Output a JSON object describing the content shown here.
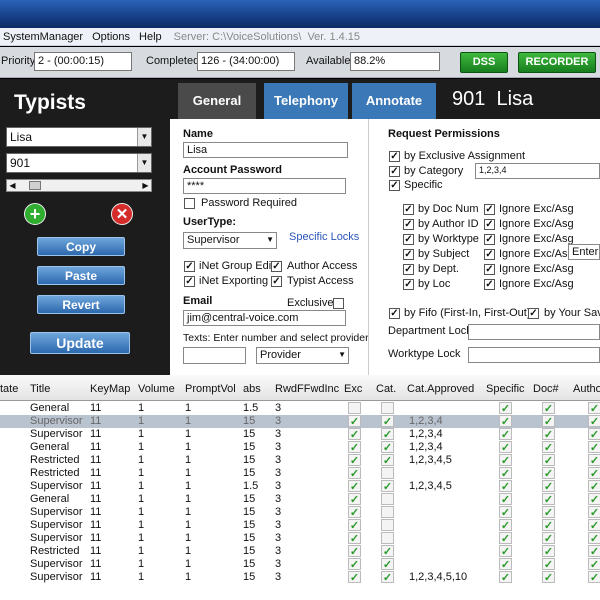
{
  "menu": {
    "system": "SystemManager",
    "options": "Options",
    "help": "Help",
    "server_label": "Server: C:\\VoiceSolutions\\",
    "version": "Ver. 1.4.15"
  },
  "toolbar": {
    "priority_label": "Priority",
    "priority_value": "2 - (00:00:15)",
    "completed_label": "Completed",
    "completed_value": "126 - (34:00:00)",
    "available_label": "Available",
    "available_value": "88.2%",
    "dss_label": "DSS",
    "recorder_label": "RECORDER"
  },
  "left": {
    "title": "Typists",
    "user_select": "Lisa",
    "id_select": "901",
    "copy": "Copy",
    "paste": "Paste",
    "revert": "Revert",
    "update": "Update",
    "add_icon": "plus-icon",
    "remove_icon": "x-icon"
  },
  "tabs": {
    "general": "General",
    "telephony": "Telephony",
    "annotate": "Annotate",
    "typist_id": "901",
    "typist_name": "Lisa"
  },
  "form": {
    "name_label": "Name",
    "name_value": "Lisa",
    "password_label": "Account Password",
    "password_value": "****",
    "password_required": "Password Required",
    "usertype_label": "UserType:",
    "usertype_value": "Supervisor",
    "specific_locks": "Specific Locks",
    "inet_group_edit": "iNet Group Edit",
    "author_access": "Author Access",
    "inet_exporting": "iNet Exporting",
    "typist_access": "Typist Access",
    "email_label": "Email",
    "exclusive_label": "Exclusive",
    "email_value": "jim@central-voice.com",
    "texts_label": "Texts: Enter number and select provider",
    "provider_value": "Provider",
    "perm_title": "Request Permissions",
    "by_exclusive": "by Exclusive Assignment",
    "by_category": "by Category",
    "category_value": "1,2,3,4",
    "specific": "Specific",
    "sub": [
      {
        "l": "by Doc Num",
        "r": "Ignore Exc/Asg"
      },
      {
        "l": "by Author ID",
        "r": "Ignore Exc/Asg"
      },
      {
        "l": "by Worktype",
        "r": "Ignore Exc/Asg"
      },
      {
        "l": "by Subject",
        "r": "Ignore Exc/Asg"
      },
      {
        "l": "by Dept.",
        "r": "Ignore Exc/Asg"
      },
      {
        "l": "by Loc",
        "r": "Ignore Exc/Asg"
      }
    ],
    "enter_hint": "EnterS",
    "by_fifo": "by Fifo (First-In, First-Out)",
    "by_your_save": "by Your Save",
    "dept_lock": "Department Lock",
    "worktype_lock": "Worktype Lock"
  },
  "grid": {
    "headers": [
      "tate",
      "Title",
      "KeyMap",
      "Volume",
      "PromptVol",
      "abs",
      "RwdFFwdInc",
      "Exc",
      "Cat.",
      "Cat.Approved",
      "Specific",
      "Doc#",
      "Autho"
    ],
    "rows": [
      {
        "title": "General",
        "keymap": "11",
        "volume": "1",
        "prompt": "1",
        "abs": "1.5",
        "rwd": "3",
        "exc": false,
        "cat": false,
        "approved": ""
      },
      {
        "title": "Supervisor",
        "keymap": "11",
        "volume": "1",
        "prompt": "1",
        "abs": "15",
        "rwd": "3",
        "exc": true,
        "cat": true,
        "approved": "1,2,3,4"
      },
      {
        "title": "Supervisor",
        "keymap": "11",
        "volume": "1",
        "prompt": "1",
        "abs": "15",
        "rwd": "3",
        "exc": true,
        "cat": true,
        "approved": "1,2,3,4"
      },
      {
        "title": "General",
        "keymap": "11",
        "volume": "1",
        "prompt": "1",
        "abs": "15",
        "rwd": "3",
        "exc": true,
        "cat": true,
        "approved": "1,2,3,4"
      },
      {
        "title": "Restricted",
        "keymap": "11",
        "volume": "1",
        "prompt": "1",
        "abs": "15",
        "rwd": "3",
        "exc": true,
        "cat": true,
        "approved": "1,2,3,4,5"
      },
      {
        "title": "Restricted",
        "keymap": "11",
        "volume": "1",
        "prompt": "1",
        "abs": "15",
        "rwd": "3",
        "exc": true,
        "cat": false,
        "approved": ""
      },
      {
        "title": "Supervisor",
        "keymap": "11",
        "volume": "1",
        "prompt": "1",
        "abs": "1.5",
        "rwd": "3",
        "exc": true,
        "cat": true,
        "approved": "1,2,3,4,5"
      },
      {
        "title": "General",
        "keymap": "11",
        "volume": "1",
        "prompt": "1",
        "abs": "15",
        "rwd": "3",
        "exc": true,
        "cat": false,
        "approved": ""
      },
      {
        "title": "Supervisor",
        "keymap": "11",
        "volume": "1",
        "prompt": "1",
        "abs": "15",
        "rwd": "3",
        "exc": true,
        "cat": false,
        "approved": ""
      },
      {
        "title": "Supervisor",
        "keymap": "11",
        "volume": "1",
        "prompt": "1",
        "abs": "15",
        "rwd": "3",
        "exc": true,
        "cat": false,
        "approved": ""
      },
      {
        "title": "Supervisor",
        "keymap": "11",
        "volume": "1",
        "prompt": "1",
        "abs": "15",
        "rwd": "3",
        "exc": true,
        "cat": false,
        "approved": ""
      },
      {
        "title": "Restricted",
        "keymap": "11",
        "volume": "1",
        "prompt": "1",
        "abs": "15",
        "rwd": "3",
        "exc": true,
        "cat": true,
        "approved": ""
      },
      {
        "title": "Supervisor",
        "keymap": "11",
        "volume": "1",
        "prompt": "1",
        "abs": "15",
        "rwd": "3",
        "exc": true,
        "cat": true,
        "approved": ""
      },
      {
        "title": "Supervisor",
        "keymap": "11",
        "volume": "1",
        "prompt": "1",
        "abs": "15",
        "rwd": "3",
        "exc": true,
        "cat": true,
        "approved": "1,2,3,4,5,10"
      }
    ],
    "selected_row": 1
  },
  "colors": {
    "accent": "#2c68ad",
    "check": "#2a9a2a",
    "dark_panel": "#1c1c1c",
    "tab_active": "#3a78b8"
  }
}
